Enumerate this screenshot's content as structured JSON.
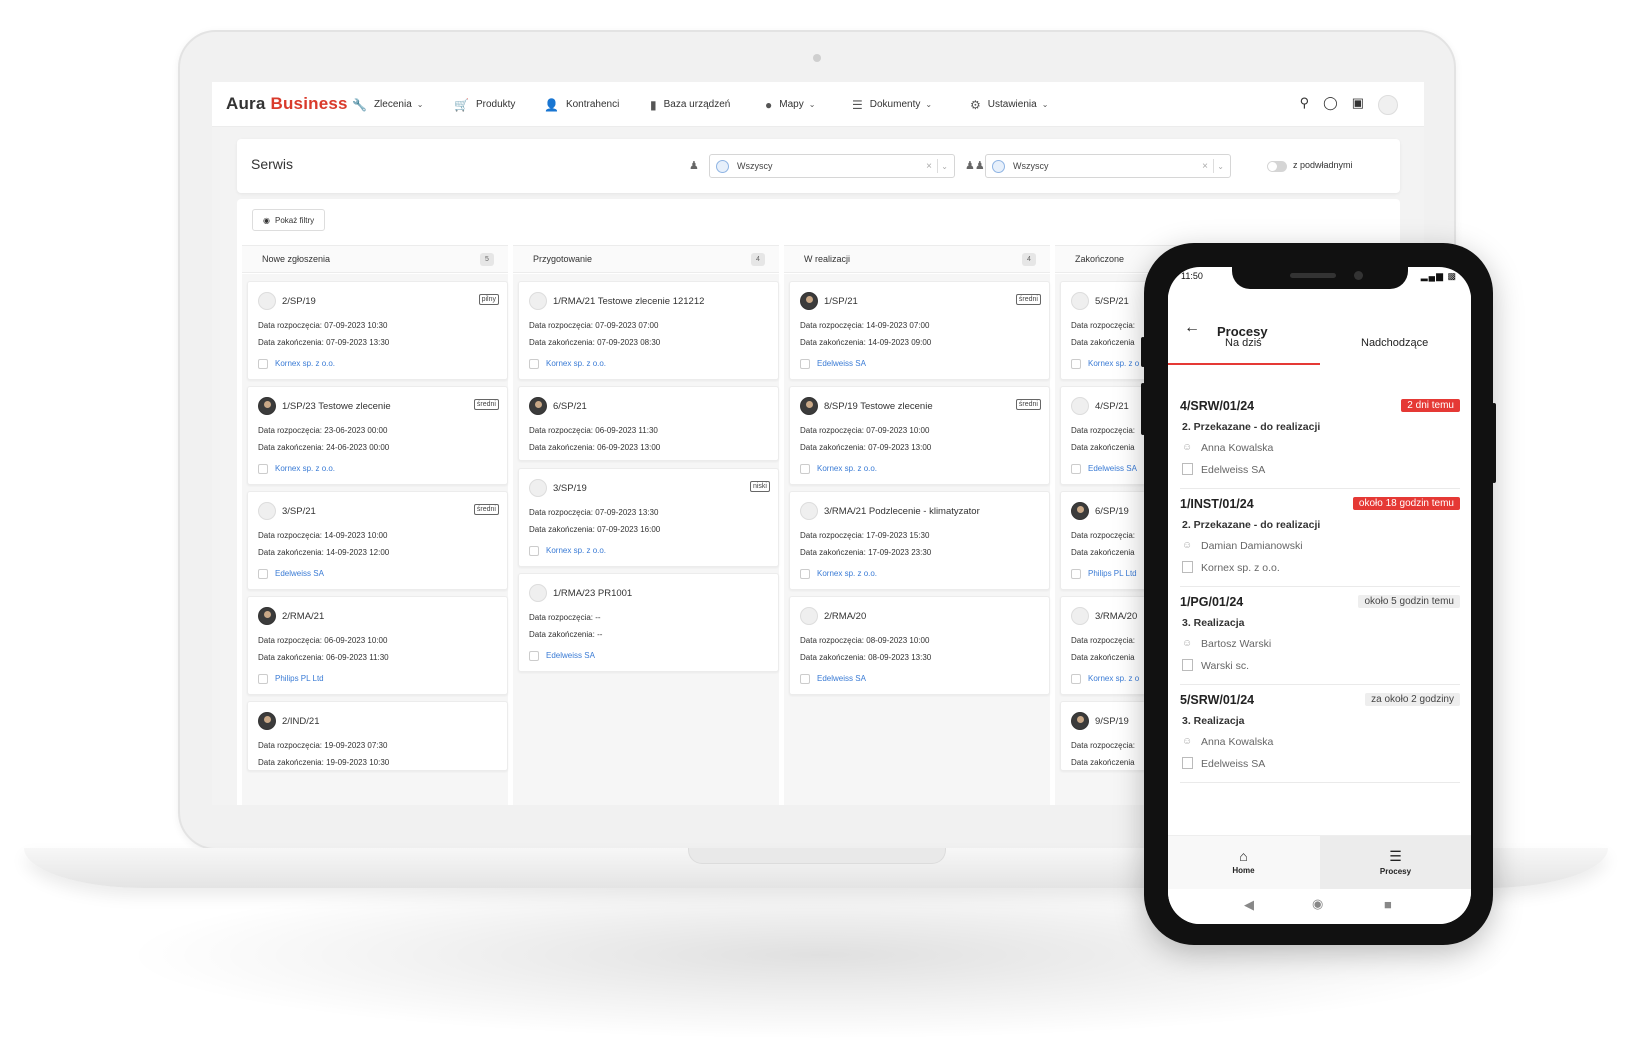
{
  "app": {
    "logo_a": "Aura",
    "logo_b": "Business"
  },
  "nav": [
    {
      "label": "Zlecenia",
      "icon": "wrench-icon",
      "dropdown": true
    },
    {
      "label": "Produkty",
      "icon": "cart-icon",
      "dropdown": false
    },
    {
      "label": "Kontrahenci",
      "icon": "person-icon",
      "dropdown": false
    },
    {
      "label": "Baza urządzeń",
      "icon": "barcode-icon",
      "dropdown": false
    },
    {
      "label": "Mapy",
      "icon": "pin-icon",
      "dropdown": true
    },
    {
      "label": "Dokumenty",
      "icon": "list-icon",
      "dropdown": true
    },
    {
      "label": "Ustawienia",
      "icon": "gear-icon",
      "dropdown": true
    }
  ],
  "page": {
    "title": "Serwis",
    "select1": "Wszyscy",
    "select2": "Wszyscy",
    "toggle_label": "z podwładnymi",
    "filter_btn": "Pokaż filtry"
  },
  "columns": [
    {
      "title": "Nowe zgłoszenia",
      "count": "5"
    },
    {
      "title": "Przygotowanie",
      "count": "4"
    },
    {
      "title": "W realizacji",
      "count": "4"
    },
    {
      "title": "Zakończone",
      "count": ""
    }
  ],
  "labels": {
    "start": "Data rozpoczęcia:",
    "end": "Data zakończenia:"
  },
  "cards": {
    "c1": [
      {
        "title": "2/SP/19",
        "tag": "pilny",
        "start": "07-09-2023 10:30",
        "end": "07-09-2023 13:30",
        "company": "Kornex sp. z o.o.",
        "dark": false
      },
      {
        "title": "1/SP/23 Testowe zlecenie",
        "tag": "średni",
        "start": "23-06-2023 00:00",
        "end": "24-06-2023 00:00",
        "company": "Kornex sp. z o.o.",
        "dark": true
      },
      {
        "title": "3/SP/21",
        "tag": "średni",
        "start": "14-09-2023 10:00",
        "end": "14-09-2023 12:00",
        "company": "Edelweiss SA",
        "dark": false
      },
      {
        "title": "2/RMA/21",
        "tag": "",
        "start": "06-09-2023 10:00",
        "end": "06-09-2023 11:30",
        "company": "Philips PL Ltd",
        "dark": true
      },
      {
        "title": "2/IND/21",
        "tag": "",
        "start": "19-09-2023 07:30",
        "end": "19-09-2023 10:30",
        "company": "",
        "dark": true
      }
    ],
    "c2": [
      {
        "title": "1/RMA/21 Testowe zlecenie 121212",
        "tag": "",
        "start": "07-09-2023 07:00",
        "end": "07-09-2023 08:30",
        "company": "Kornex sp. z o.o.",
        "dark": false
      },
      {
        "title": "6/SP/21",
        "tag": "",
        "start": "06-09-2023 11:30",
        "end": "06-09-2023 13:00",
        "company": "",
        "dark": true
      },
      {
        "title": "3/SP/19",
        "tag": "niski",
        "start": "07-09-2023 13:30",
        "end": "07-09-2023 16:00",
        "company": "Kornex sp. z o.o.",
        "dark": false
      },
      {
        "title": "1/RMA/23 PR1001",
        "tag": "",
        "start": "--",
        "end": "--",
        "company": "Edelweiss SA",
        "dark": false
      }
    ],
    "c3": [
      {
        "title": "1/SP/21",
        "tag": "średni",
        "start": "14-09-2023 07:00",
        "end": "14-09-2023 09:00",
        "company": "Edelweiss SA",
        "dark": true
      },
      {
        "title": "8/SP/19 Testowe zlecenie",
        "tag": "średni",
        "start": "07-09-2023 10:00",
        "end": "07-09-2023 13:00",
        "company": "Kornex sp. z o.o.",
        "dark": true
      },
      {
        "title": "3/RMA/21 Podzlecenie - klimatyzator",
        "tag": "",
        "start": "17-09-2023 15:30",
        "end": "17-09-2023 23:30",
        "company": "Kornex sp. z o.o.",
        "dark": false
      },
      {
        "title": "2/RMA/20",
        "tag": "",
        "start": "08-09-2023 10:00",
        "end": "08-09-2023 13:30",
        "company": "Edelweiss SA",
        "dark": false
      }
    ],
    "c4": [
      {
        "title": "5/SP/21",
        "start_lbl": "Data rozpoczęcia:",
        "end_lbl": "Data zakończenia",
        "company": "Kornex sp. z o",
        "dark": false
      },
      {
        "title": "4/SP/21",
        "start_lbl": "Data rozpoczęcia:",
        "end_lbl": "Data zakończenia",
        "company": "Edelweiss SA",
        "dark": false
      },
      {
        "title": "6/SP/19",
        "start_lbl": "Data rozpoczęcia:",
        "end_lbl": "Data zakończenia",
        "company": "Philips PL Ltd",
        "dark": true
      },
      {
        "title": "3/RMA/20",
        "start_lbl": "Data rozpoczęcia:",
        "end_lbl": "Data zakończenia",
        "company": "Kornex sp. z o",
        "dark": false
      },
      {
        "title": "9/SP/19",
        "start_lbl": "Data rozpoczęcia:",
        "end_lbl": "Data zakończenia",
        "company": "",
        "dark": true
      }
    ]
  },
  "phone": {
    "time": "11:50",
    "title": "Procesy",
    "tabs": [
      "Na dziś",
      "Nadchodzące"
    ],
    "items": [
      {
        "id": "4/SRW/01/24",
        "badge": "2 dni temu",
        "badge_style": "red",
        "status": "2. Przekazane - do realizacji",
        "person": "Anna Kowalska",
        "company": "Edelweiss SA"
      },
      {
        "id": "1/INST/01/24",
        "badge": "około 18 godzin temu",
        "badge_style": "red",
        "status": "2. Przekazane - do realizacji",
        "person": "Damian Damianowski",
        "company": "Kornex sp. z o.o."
      },
      {
        "id": "1/PG/01/24",
        "badge": "około 5 godzin temu",
        "badge_style": "gray",
        "status": "3. Realizacja",
        "person": "Bartosz Warski",
        "company": "Warski sc."
      },
      {
        "id": "5/SRW/01/24",
        "badge": "za około 2 godziny",
        "badge_style": "gray",
        "status": "3. Realizacja",
        "person": "Anna Kowalska",
        "company": "Edelweiss SA"
      }
    ],
    "nav": [
      {
        "label": "Home",
        "icon": "home-icon"
      },
      {
        "label": "Procesy",
        "icon": "list-icon"
      }
    ]
  },
  "colors": {
    "brand": "#d93a2b",
    "link": "#3a7bd5",
    "badge_red": "#e53935"
  }
}
